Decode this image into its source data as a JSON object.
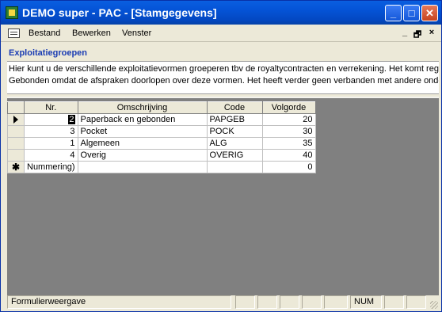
{
  "window": {
    "title": "DEMO super - PAC - [Stamgegevens]",
    "minimize_glyph": "_",
    "maximize_glyph": "□",
    "close_glyph": "✕"
  },
  "menu": {
    "items": [
      "Bestand",
      "Bewerken",
      "Venster"
    ],
    "mdi_minimize": "_",
    "mdi_restore": "🗗",
    "mdi_close": "×"
  },
  "form": {
    "title": "Exploitatiegroepen",
    "description_lines": [
      "Hier kunt u de verschillende exploitatievormen groeperen tbv de royaltycontracten en verrekening. Het komt reg",
      "Gebonden omdat de afspraken doorlopen over deze vormen. Het heeft verder geen verbanden met andere onde"
    ]
  },
  "table": {
    "headers": [
      "Nr.",
      "Omschrijving",
      "Code",
      "Volgorde"
    ],
    "rows": [
      {
        "nr": "2",
        "omschrijving": "Paperback en gebonden",
        "code": "PAPGEB",
        "volgorde": "20",
        "selector": "current"
      },
      {
        "nr": "3",
        "omschrijving": "Pocket",
        "code": "POCK",
        "volgorde": "30",
        "selector": ""
      },
      {
        "nr": "1",
        "omschrijving": "Algemeen",
        "code": "ALG",
        "volgorde": "35",
        "selector": ""
      },
      {
        "nr": "4",
        "omschrijving": "Overig",
        "code": "OVERIG",
        "volgorde": "40",
        "selector": ""
      }
    ],
    "new_row": {
      "nr": "Nummering)",
      "omschrijving": "",
      "code": "",
      "volgorde": "0",
      "selector_glyph": "✱"
    }
  },
  "status": {
    "text": "Formulierweergave",
    "num": "NUM"
  },
  "colors": {
    "titlebar": "#0453d6",
    "form_title": "#1a3cb3",
    "grid_background": "#808080"
  }
}
